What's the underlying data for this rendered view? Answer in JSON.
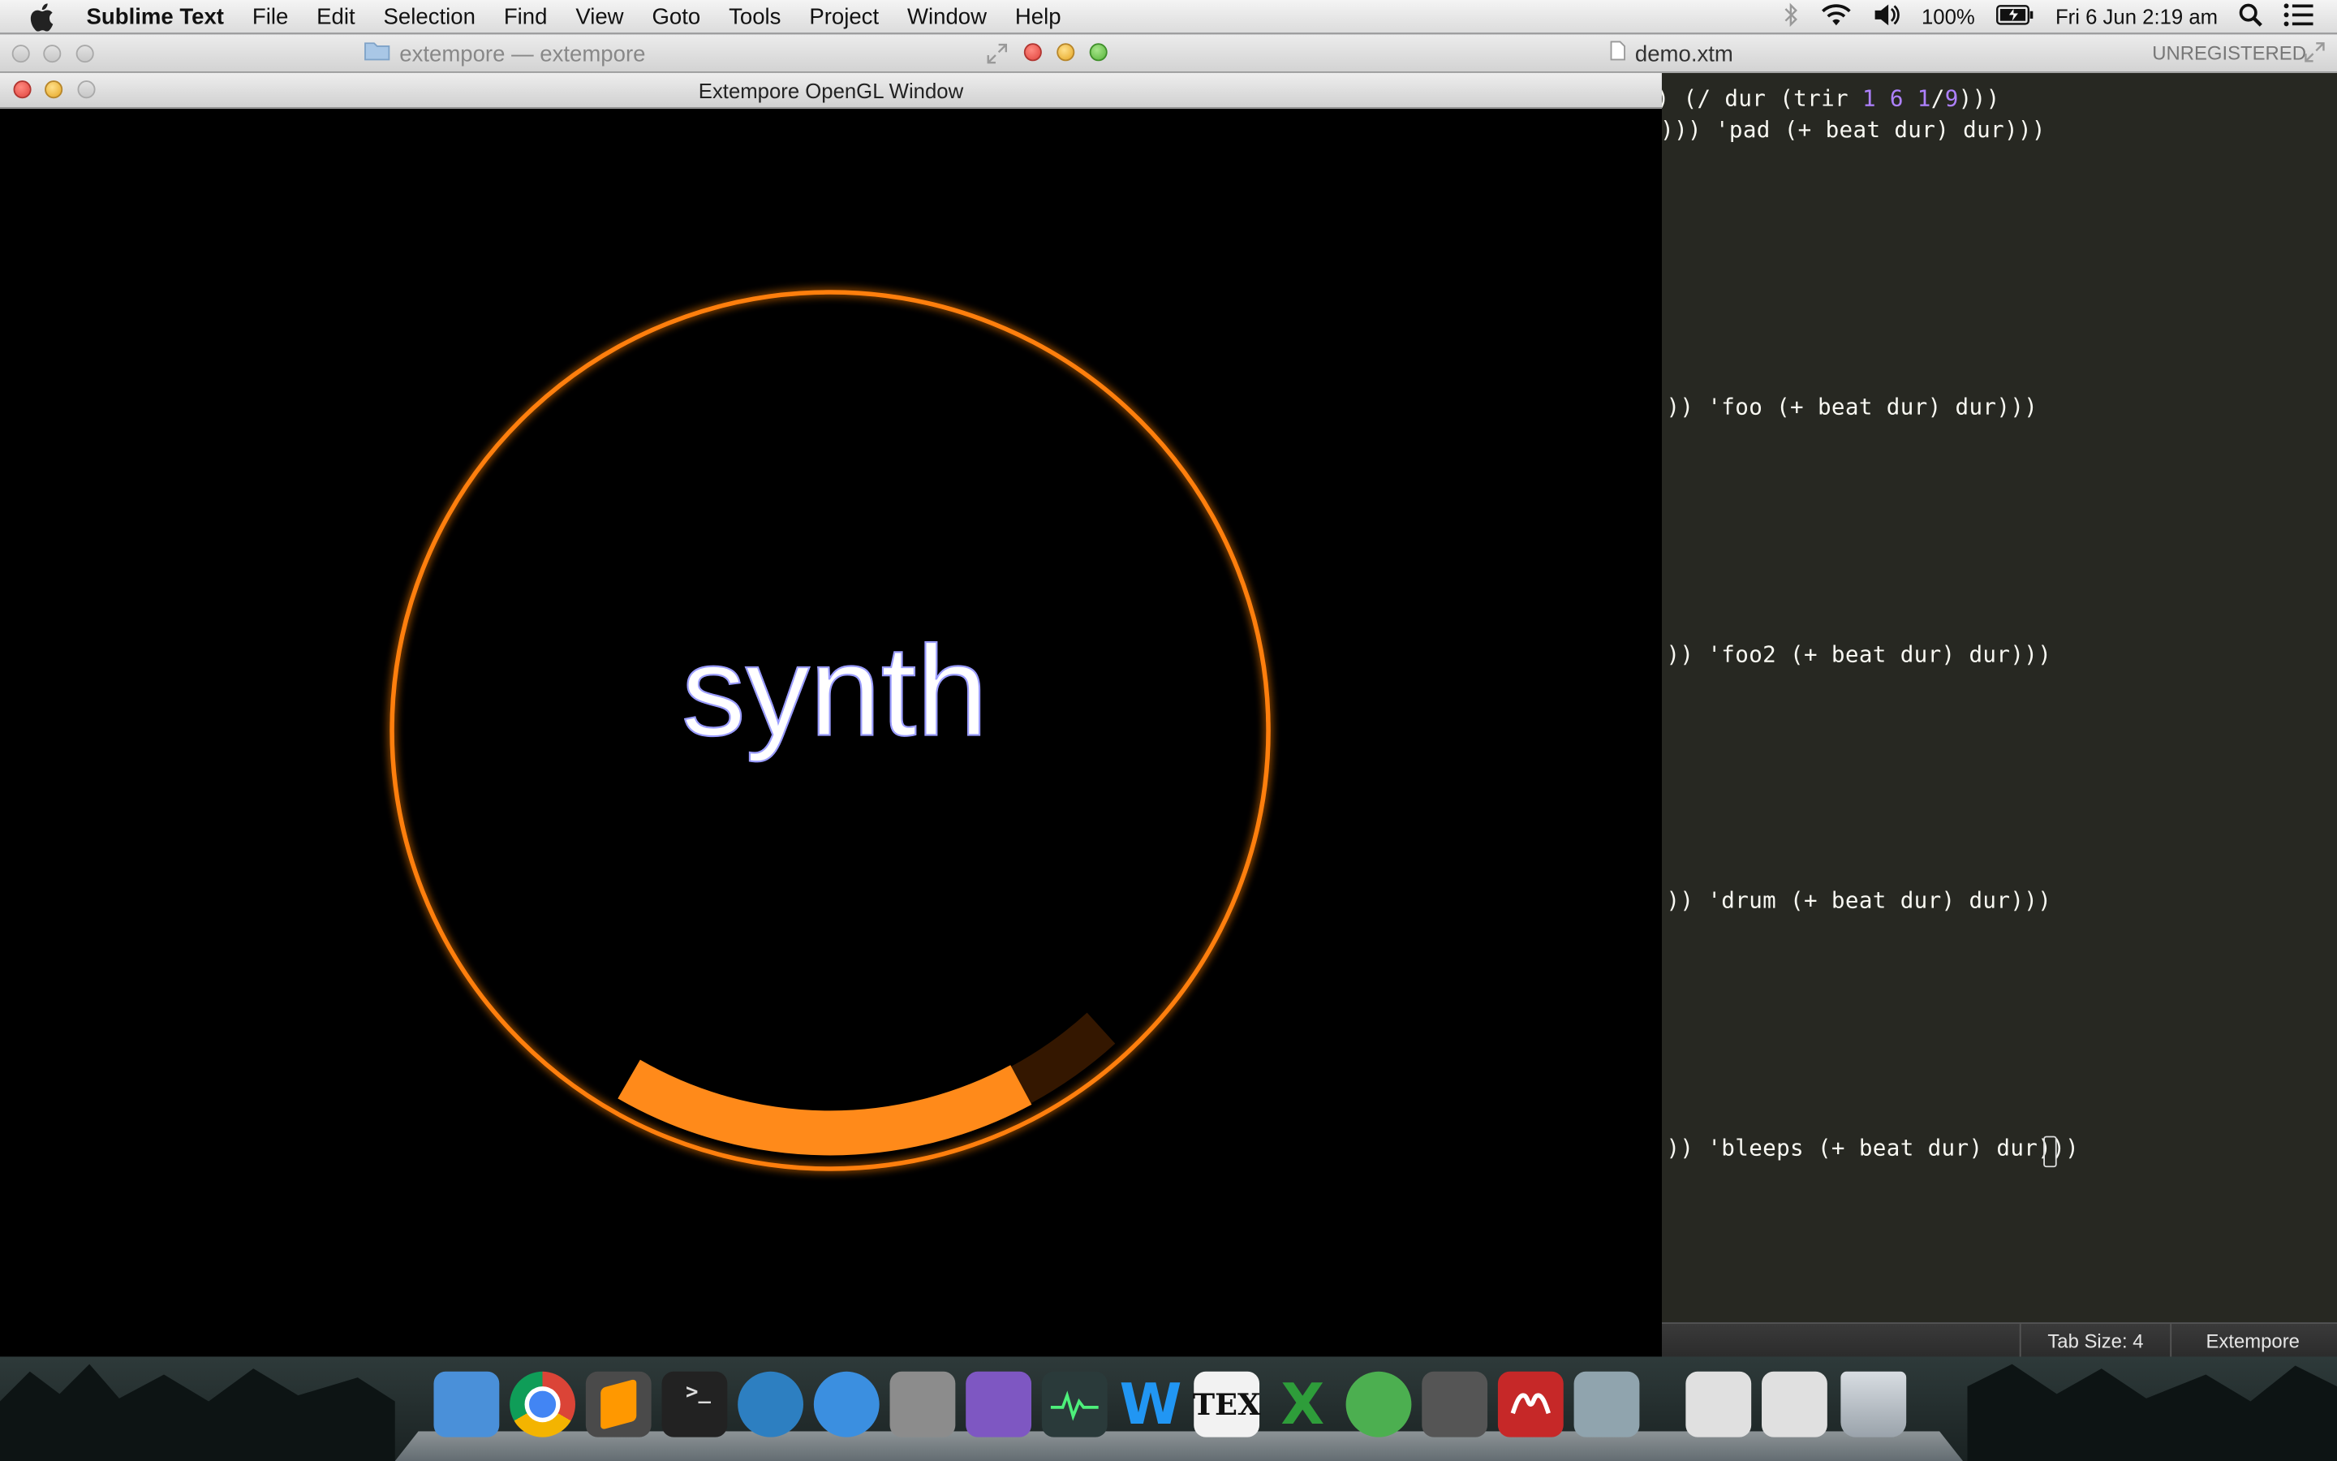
{
  "menubar": {
    "app_name": "Sublime Text",
    "items": [
      "File",
      "Edit",
      "Selection",
      "Find",
      "View",
      "Goto",
      "Tools",
      "Project",
      "Window",
      "Help"
    ],
    "battery": "100%",
    "datetime": "Fri 6 Jun  2:19 am"
  },
  "sublime": {
    "project_title": "extempore — extempore",
    "file_title": "demo.xtm",
    "unregistered": "UNREGISTERED"
  },
  "gl_window": {
    "title": "Extempore OpenGL Window",
    "center_text": "synth",
    "arc_progress": 0.36,
    "accent": "#ff8a1a"
  },
  "editor": {
    "lines": [
      {
        "a": ") (/ dur (trir ",
        "n1": "1",
        "n2": "6",
        "n3": "1",
        "b": "/",
        "n4": "9",
        "c": ")))"
      },
      {
        "text": "))) 'pad (+ beat dur) dur)))"
      },
      {
        "text": ")) 'foo (+ beat dur) dur)))"
      },
      {
        "text": ")) 'foo2 (+ beat dur) dur)))"
      },
      {
        "text": ")) 'drum (+ beat dur) dur)))"
      },
      {
        "text": ")) 'bleeps (+ beat dur) dur)))"
      }
    ]
  },
  "statusbar": {
    "tab_size": "Tab Size: 4",
    "syntax": "Extempore"
  },
  "dock": {
    "apps": [
      {
        "name": "Finder",
        "icon": "finder-icon",
        "color": "#4a90d9"
      },
      {
        "name": "Chrome",
        "icon": "chrome-icon",
        "color": "#dd4b39"
      },
      {
        "name": "Sublime Text",
        "icon": "sublime-icon",
        "color": "#ff9800"
      },
      {
        "name": "Terminal",
        "icon": "terminal-icon",
        "color": "#222222"
      },
      {
        "name": "SourceTree",
        "icon": "sourcetree-icon",
        "color": "#2d7fc1"
      },
      {
        "name": "iTunes",
        "icon": "itunes-icon",
        "color": "#3b8fe0"
      },
      {
        "name": "System Preferences",
        "icon": "system-preferences-icon",
        "color": "#8c8c8c"
      },
      {
        "name": "Bit Slicer",
        "icon": "rocket-icon",
        "color": "#7e57c2"
      },
      {
        "name": "Activity Monitor",
        "icon": "activity-monitor-icon",
        "color": "#2a3a3a"
      },
      {
        "name": "Word",
        "icon": "word-icon",
        "color": "#1e88e5"
      },
      {
        "name": "TeX",
        "icon": "tex-icon",
        "color": "#f2f2f2"
      },
      {
        "name": "Excel",
        "icon": "excel-icon",
        "color": "#2e7d32"
      },
      {
        "name": "uTorrent",
        "icon": "utorrent-icon",
        "color": "#4caf50"
      },
      {
        "name": "Console",
        "icon": "console-icon",
        "color": "#555555"
      },
      {
        "name": "Mendeley",
        "icon": "mendeley-icon",
        "color": "#c62828"
      },
      {
        "name": "Preview",
        "icon": "preview-icon",
        "color": "#90a4ae"
      },
      {
        "name": "Documents stack",
        "icon": "documents-stack-icon",
        "color": "#e0e0e0"
      },
      {
        "name": "Downloads stack",
        "icon": "downloads-stack-icon",
        "color": "#e0e0e0"
      },
      {
        "name": "Trash",
        "icon": "trash-icon",
        "color": "#b0b8c0"
      }
    ]
  }
}
